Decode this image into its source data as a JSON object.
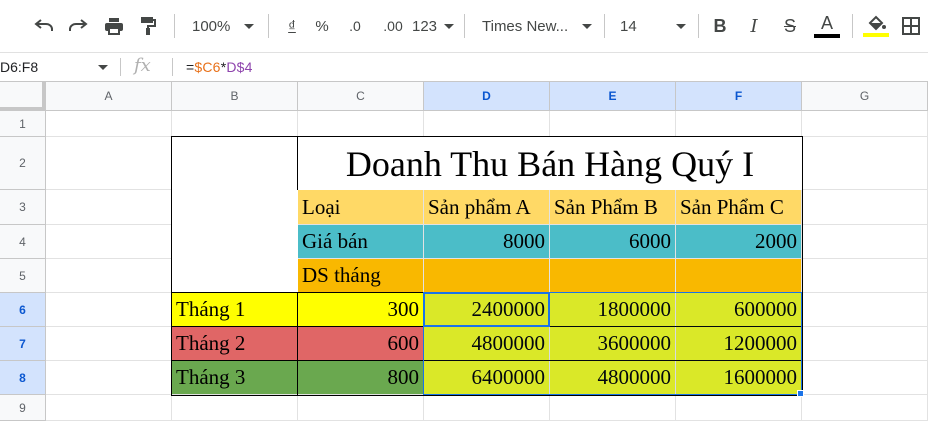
{
  "toolbar": {
    "zoom": "100%",
    "currency": "₫",
    "percent": "%",
    "dec_decrease": ".0",
    "dec_increase": ".00",
    "more_formats": "123",
    "font_family": "Times New...",
    "font_size": "14",
    "text_color": "#000000",
    "highlight_color": "#ffff00",
    "icons": [
      "undo-icon",
      "redo-icon",
      "print-icon",
      "paint-format-icon",
      "bold-icon",
      "italic-icon",
      "strikethrough-icon",
      "text-color-icon",
      "fill-color-icon",
      "borders-icon"
    ]
  },
  "formula_bar": {
    "name_box": "D6:F8",
    "fx": "fx",
    "formula_prefix": "=",
    "formula_ref1": "$C6",
    "formula_op": "*",
    "formula_ref2": "D$4"
  },
  "columns": [
    "A",
    "B",
    "C",
    "D",
    "E",
    "F",
    "G"
  ],
  "rows": [
    "1",
    "2",
    "3",
    "4",
    "5",
    "6",
    "7",
    "8",
    "9"
  ],
  "table": {
    "title": "Doanh Thu Bán Hàng Quý I",
    "header": [
      "Loại",
      "Sản phẩm A",
      "Sản Phẩm B",
      "Sản Phẩm C"
    ],
    "price_row": {
      "label": "Giá bán",
      "values": [
        "8000",
        "6000",
        "2000"
      ]
    },
    "ds_row": {
      "label": "DS tháng"
    },
    "months": [
      {
        "label": "Tháng 1",
        "qty": "300",
        "values": [
          "2400000",
          "1800000",
          "600000"
        ]
      },
      {
        "label": "Tháng 2",
        "qty": "600",
        "values": [
          "4800000",
          "3600000",
          "1200000"
        ]
      },
      {
        "label": "Tháng 3",
        "qty": "800",
        "values": [
          "6400000",
          "4800000",
          "1600000"
        ]
      }
    ]
  },
  "colors": {
    "header_fill": "#ffd966",
    "price_fill": "#4bbdc8",
    "ds_fill": "#f9b800",
    "result_fill": "#e6f01c",
    "month1_fill": "#ffff00",
    "month2_fill": "#e06666",
    "month3_fill": "#6aa84f",
    "selection": "#1a73e8"
  }
}
